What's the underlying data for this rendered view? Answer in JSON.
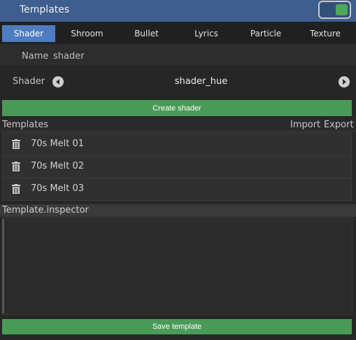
{
  "window": {
    "title": "Templates"
  },
  "tabs": [
    {
      "label": "Shader",
      "active": true
    },
    {
      "label": "Shroom",
      "active": false
    },
    {
      "label": "Bullet",
      "active": false
    },
    {
      "label": "Lyrics",
      "active": false
    },
    {
      "label": "Particle",
      "active": false
    },
    {
      "label": "Texture",
      "active": false
    }
  ],
  "name_field": {
    "label": "Name",
    "value": "shader"
  },
  "shader_selector": {
    "label": "Shader",
    "value": "shader_hue",
    "prev_icon": "arrow-left-circle-icon",
    "next_icon": "arrow-right-circle-icon"
  },
  "create_button": {
    "label": "Create shader"
  },
  "templates": {
    "title": "Templates",
    "import_label": "Import",
    "export_label": "Export",
    "items": [
      {
        "name": "70s Melt 01",
        "icon": "trash-icon"
      },
      {
        "name": "70s Melt 02",
        "icon": "trash-icon"
      },
      {
        "name": "70s Melt 03",
        "icon": "trash-icon"
      }
    ]
  },
  "inspector": {
    "title": "Template.inspector"
  },
  "save_button": {
    "label": "Save template"
  },
  "colors": {
    "title_bar": "#3d5e8e",
    "active_tab": "#4e7cc0",
    "toggle_on": "#4ea85a",
    "button_green": "#4a9a58"
  }
}
